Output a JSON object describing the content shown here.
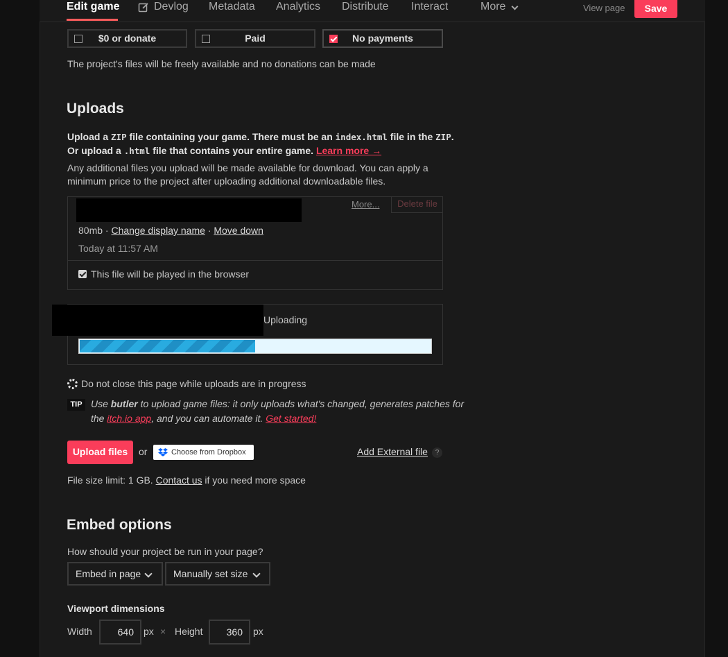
{
  "nav": {
    "tabs": [
      {
        "label": "Edit game"
      },
      {
        "label": "Devlog"
      },
      {
        "label": "Metadata"
      },
      {
        "label": "Analytics"
      },
      {
        "label": "Distribute"
      },
      {
        "label": "Interact"
      },
      {
        "label": "More"
      }
    ],
    "view_page": "View page",
    "save": "Save"
  },
  "pricing": {
    "options": [
      {
        "label": "$0 or donate",
        "checked": false
      },
      {
        "label": "Paid",
        "checked": false
      },
      {
        "label": "No payments",
        "checked": true
      }
    ],
    "description": "The project's files will be freely available and no donations can be made"
  },
  "uploads": {
    "heading": "Uploads",
    "intro_1a": "Upload a ",
    "intro_zip": "ZIP",
    "intro_1b": " file containing your game. There must be an ",
    "intro_index": "index.html",
    "intro_1c": " file in the ",
    "intro_zip2": "ZIP",
    "intro_1d": ".",
    "intro_2a": "Or upload a ",
    "intro_html": ".html",
    "intro_2b": " file that contains your entire game. ",
    "learn_more": "Learn more →",
    "additional_1": "Any additional files you upload will be made available for download. You can apply a",
    "additional_2": "minimum price to the project after uploading additional downloadable files.",
    "file": {
      "more": "More...",
      "delete": "Delete file",
      "size": "80mb · ",
      "change_name": "Change display name",
      "sep": " · ",
      "move_down": "Move down",
      "timestamp": "Today at 11:57 AM",
      "play_in_browser": "This file will be played in the browser"
    },
    "in_progress": {
      "status": "Uploading",
      "progress": 0.5
    },
    "warning": "Do not close this page while uploads are in progress",
    "tip": {
      "badge": "TIP",
      "t1": "Use ",
      "butler": "butler",
      "t2": " to upload game files: it only uploads what's changed, generates patches for",
      "t3": "the ",
      "app": "itch.io app",
      "t4": ", and you can automate it. ",
      "get_started": "Get started!"
    },
    "upload_button": "Upload files",
    "or": "or",
    "dropbox": "Choose from Dropbox",
    "external": "Add External file",
    "help": "?",
    "limit_a": "File size limit: 1 GB. ",
    "contact": "Contact us",
    "limit_b": " if you need more space"
  },
  "embed": {
    "heading": "Embed options",
    "question": "How should your project be run in your page?",
    "mode": "Embed in page",
    "sizing": "Manually set size",
    "viewport_heading": "Viewport dimensions",
    "width_label": "Width",
    "width": "640",
    "px1": "px",
    "times": "×",
    "height_label": "Height",
    "height": "360",
    "px2": "px"
  },
  "colors": {
    "accent": "#fa3d5a",
    "progress": "#29abe0"
  }
}
